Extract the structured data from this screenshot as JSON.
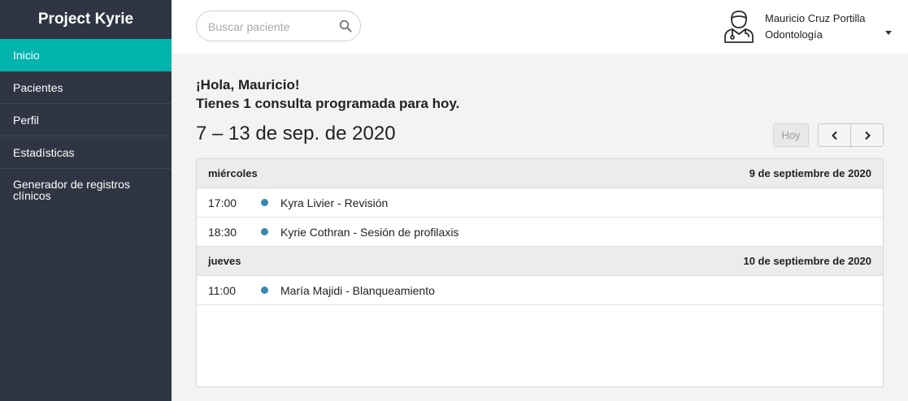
{
  "app": {
    "title": "Project Kyrie"
  },
  "sidebar": {
    "items": [
      {
        "label": "Inicio"
      },
      {
        "label": "Pacientes"
      },
      {
        "label": "Perfil"
      },
      {
        "label": "Estadísticas"
      },
      {
        "label": "Generador de registros clínicos"
      }
    ],
    "active": "Inicio"
  },
  "search": {
    "placeholder": "Buscar paciente",
    "value": ""
  },
  "user": {
    "name": "Mauricio Cruz Portilla",
    "role": "Odontología"
  },
  "greeting": {
    "line1": "¡Hola, Mauricio!",
    "line2": "Tienes 1 consulta programada para hoy."
  },
  "calendar": {
    "range_title": "7 – 13 de sep. de 2020",
    "today_label": "Hoy",
    "days": [
      {
        "weekday": "miércoles",
        "date": "9 de septiembre de 2020",
        "events": [
          {
            "time": "17:00",
            "title": "Kyra Livier - Revisión"
          },
          {
            "time": "18:30",
            "title": "Kyrie Cothran - Sesión de profilaxis"
          }
        ]
      },
      {
        "weekday": "jueves",
        "date": "10 de septiembre de 2020",
        "events": [
          {
            "time": "11:00",
            "title": "María Majidi - Blanqueamiento"
          }
        ]
      }
    ]
  },
  "colors": {
    "sidebar_bg": "#2f3542",
    "accent": "#00b5ad",
    "event_dot": "#3a87ad"
  },
  "icons": [
    "search-icon",
    "doctor-avatar-icon",
    "caret-down-icon",
    "chevron-left-icon",
    "chevron-right-icon"
  ]
}
